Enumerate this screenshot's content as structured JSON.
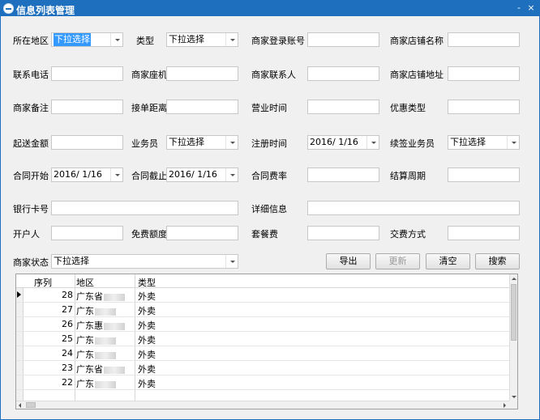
{
  "window": {
    "title": "信息列表管理",
    "minimize_glyph": "-",
    "close_glyph": "×"
  },
  "form": {
    "region": {
      "label": "所在地区",
      "value": "下拉选择"
    },
    "type": {
      "label": "类型",
      "value": "下拉选择"
    },
    "login_account": {
      "label": "商家登录账号",
      "value": ""
    },
    "shop_name": {
      "label": "商家店铺名称",
      "value": ""
    },
    "phone": {
      "label": "联系电话",
      "value": ""
    },
    "landline": {
      "label": "商家座机",
      "value": ""
    },
    "contact": {
      "label": "商家联系人",
      "value": ""
    },
    "shop_address": {
      "label": "商家店铺地址",
      "value": ""
    },
    "remark": {
      "label": "商家备注",
      "value": ""
    },
    "distance": {
      "label": "接单距离",
      "value": ""
    },
    "business_hours": {
      "label": "营业时间",
      "value": ""
    },
    "promo_type": {
      "label": "优惠类型",
      "value": ""
    },
    "min_order": {
      "label": "起送金额",
      "value": ""
    },
    "salesman": {
      "label": "业务员",
      "value": "下拉选择"
    },
    "register_time": {
      "label": "注册时间",
      "value": "2016/  1/16"
    },
    "renew_salesman": {
      "label": "续签业务员",
      "value": "下拉选择"
    },
    "contract_start": {
      "label": "合同开始",
      "value": "2016/  1/16"
    },
    "contract_end": {
      "label": "合同截止",
      "value": "2016/  1/16"
    },
    "contract_rate": {
      "label": "合同费率",
      "value": ""
    },
    "settle_period": {
      "label": "结算周期",
      "value": ""
    },
    "bank_card": {
      "label": "银行卡号",
      "value": ""
    },
    "detail_info": {
      "label": "详细信息",
      "value": ""
    },
    "account_holder": {
      "label": "开户人",
      "value": ""
    },
    "free_quota": {
      "label": "免费额度",
      "value": ""
    },
    "package_fee": {
      "label": "套餐费",
      "value": ""
    },
    "payment_method": {
      "label": "交费方式",
      "value": ""
    },
    "merchant_status": {
      "label": "商家状态",
      "value": "下拉选择"
    }
  },
  "buttons": {
    "export": "导出",
    "update": "更新",
    "clear": "清空",
    "search": "搜索"
  },
  "grid": {
    "columns": [
      "序列",
      "地区",
      "类型"
    ],
    "rows": [
      {
        "seq": "28",
        "area": "广东省",
        "type": "外卖"
      },
      {
        "seq": "27",
        "area": "广东",
        "type": "外卖"
      },
      {
        "seq": "26",
        "area": "广东惠",
        "type": "外卖"
      },
      {
        "seq": "25",
        "area": "广东",
        "type": "外卖"
      },
      {
        "seq": "24",
        "area": "广东",
        "type": "外卖"
      },
      {
        "seq": "23",
        "area": "广东省",
        "type": "外卖"
      },
      {
        "seq": "22",
        "area": "广东",
        "type": "外卖"
      }
    ]
  }
}
